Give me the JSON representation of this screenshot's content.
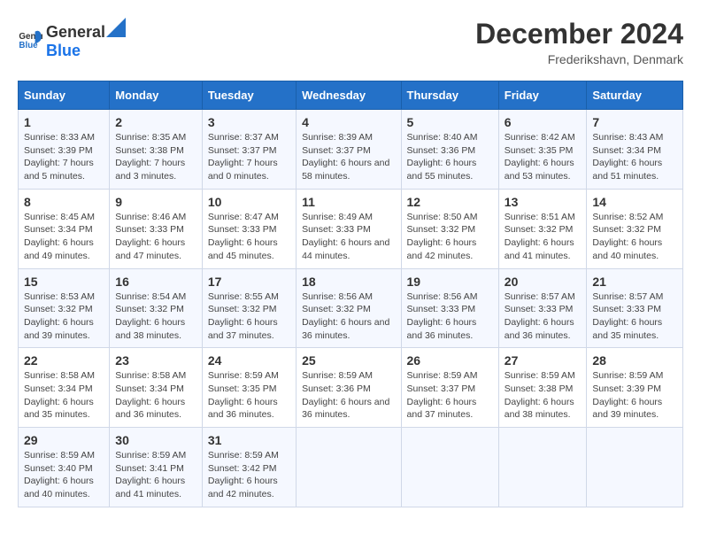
{
  "header": {
    "logo_general": "General",
    "logo_blue": "Blue",
    "title": "December 2024",
    "location": "Frederikshavn, Denmark"
  },
  "days_of_week": [
    "Sunday",
    "Monday",
    "Tuesday",
    "Wednesday",
    "Thursday",
    "Friday",
    "Saturday"
  ],
  "weeks": [
    [
      {
        "day": "1",
        "sunrise": "8:33 AM",
        "sunset": "3:39 PM",
        "daylight": "7 hours and 5 minutes."
      },
      {
        "day": "2",
        "sunrise": "8:35 AM",
        "sunset": "3:38 PM",
        "daylight": "7 hours and 3 minutes."
      },
      {
        "day": "3",
        "sunrise": "8:37 AM",
        "sunset": "3:37 PM",
        "daylight": "7 hours and 0 minutes."
      },
      {
        "day": "4",
        "sunrise": "8:39 AM",
        "sunset": "3:37 PM",
        "daylight": "6 hours and 58 minutes."
      },
      {
        "day": "5",
        "sunrise": "8:40 AM",
        "sunset": "3:36 PM",
        "daylight": "6 hours and 55 minutes."
      },
      {
        "day": "6",
        "sunrise": "8:42 AM",
        "sunset": "3:35 PM",
        "daylight": "6 hours and 53 minutes."
      },
      {
        "day": "7",
        "sunrise": "8:43 AM",
        "sunset": "3:34 PM",
        "daylight": "6 hours and 51 minutes."
      }
    ],
    [
      {
        "day": "8",
        "sunrise": "8:45 AM",
        "sunset": "3:34 PM",
        "daylight": "6 hours and 49 minutes."
      },
      {
        "day": "9",
        "sunrise": "8:46 AM",
        "sunset": "3:33 PM",
        "daylight": "6 hours and 47 minutes."
      },
      {
        "day": "10",
        "sunrise": "8:47 AM",
        "sunset": "3:33 PM",
        "daylight": "6 hours and 45 minutes."
      },
      {
        "day": "11",
        "sunrise": "8:49 AM",
        "sunset": "3:33 PM",
        "daylight": "6 hours and 44 minutes."
      },
      {
        "day": "12",
        "sunrise": "8:50 AM",
        "sunset": "3:32 PM",
        "daylight": "6 hours and 42 minutes."
      },
      {
        "day": "13",
        "sunrise": "8:51 AM",
        "sunset": "3:32 PM",
        "daylight": "6 hours and 41 minutes."
      },
      {
        "day": "14",
        "sunrise": "8:52 AM",
        "sunset": "3:32 PM",
        "daylight": "6 hours and 40 minutes."
      }
    ],
    [
      {
        "day": "15",
        "sunrise": "8:53 AM",
        "sunset": "3:32 PM",
        "daylight": "6 hours and 39 minutes."
      },
      {
        "day": "16",
        "sunrise": "8:54 AM",
        "sunset": "3:32 PM",
        "daylight": "6 hours and 38 minutes."
      },
      {
        "day": "17",
        "sunrise": "8:55 AM",
        "sunset": "3:32 PM",
        "daylight": "6 hours and 37 minutes."
      },
      {
        "day": "18",
        "sunrise": "8:56 AM",
        "sunset": "3:32 PM",
        "daylight": "6 hours and 36 minutes."
      },
      {
        "day": "19",
        "sunrise": "8:56 AM",
        "sunset": "3:33 PM",
        "daylight": "6 hours and 36 minutes."
      },
      {
        "day": "20",
        "sunrise": "8:57 AM",
        "sunset": "3:33 PM",
        "daylight": "6 hours and 36 minutes."
      },
      {
        "day": "21",
        "sunrise": "8:57 AM",
        "sunset": "3:33 PM",
        "daylight": "6 hours and 35 minutes."
      }
    ],
    [
      {
        "day": "22",
        "sunrise": "8:58 AM",
        "sunset": "3:34 PM",
        "daylight": "6 hours and 35 minutes."
      },
      {
        "day": "23",
        "sunrise": "8:58 AM",
        "sunset": "3:34 PM",
        "daylight": "6 hours and 36 minutes."
      },
      {
        "day": "24",
        "sunrise": "8:59 AM",
        "sunset": "3:35 PM",
        "daylight": "6 hours and 36 minutes."
      },
      {
        "day": "25",
        "sunrise": "8:59 AM",
        "sunset": "3:36 PM",
        "daylight": "6 hours and 36 minutes."
      },
      {
        "day": "26",
        "sunrise": "8:59 AM",
        "sunset": "3:37 PM",
        "daylight": "6 hours and 37 minutes."
      },
      {
        "day": "27",
        "sunrise": "8:59 AM",
        "sunset": "3:38 PM",
        "daylight": "6 hours and 38 minutes."
      },
      {
        "day": "28",
        "sunrise": "8:59 AM",
        "sunset": "3:39 PM",
        "daylight": "6 hours and 39 minutes."
      }
    ],
    [
      {
        "day": "29",
        "sunrise": "8:59 AM",
        "sunset": "3:40 PM",
        "daylight": "6 hours and 40 minutes."
      },
      {
        "day": "30",
        "sunrise": "8:59 AM",
        "sunset": "3:41 PM",
        "daylight": "6 hours and 41 minutes."
      },
      {
        "day": "31",
        "sunrise": "8:59 AM",
        "sunset": "3:42 PM",
        "daylight": "6 hours and 42 minutes."
      },
      null,
      null,
      null,
      null
    ]
  ]
}
